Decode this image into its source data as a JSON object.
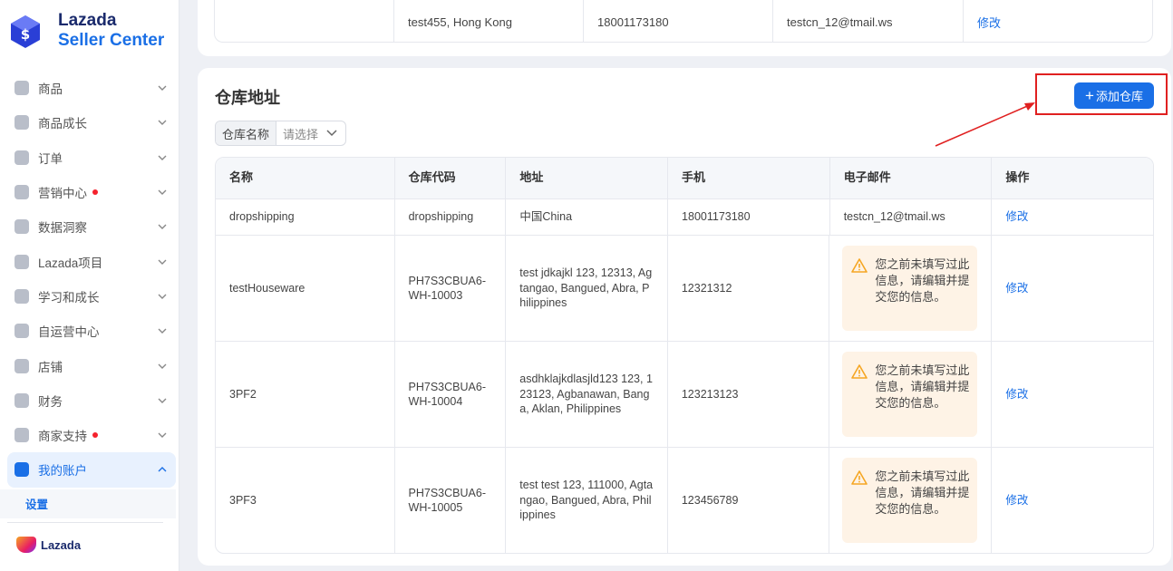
{
  "brand": {
    "line1": "Lazada",
    "line2": "Seller Center",
    "footer": "Lazada",
    "accent": "#1a6fe6"
  },
  "sidebar": {
    "items": [
      {
        "label": "商品",
        "dot": false,
        "icon": "product-icon"
      },
      {
        "label": "商品成长",
        "dot": false,
        "icon": "growth-icon"
      },
      {
        "label": "订单",
        "dot": false,
        "icon": "order-icon"
      },
      {
        "label": "营销中心",
        "dot": true,
        "icon": "marketing-icon"
      },
      {
        "label": "数据洞察",
        "dot": false,
        "icon": "data-icon"
      },
      {
        "label": "Lazada项目",
        "dot": false,
        "icon": "dollar-icon"
      },
      {
        "label": "学习和成长",
        "dot": false,
        "icon": "learning-icon"
      },
      {
        "label": "自运营中心",
        "dot": false,
        "icon": "share-icon"
      },
      {
        "label": "店铺",
        "dot": false,
        "icon": "store-icon"
      },
      {
        "label": "财务",
        "dot": false,
        "icon": "wallet-icon"
      },
      {
        "label": "商家支持",
        "dot": true,
        "icon": "help-icon"
      },
      {
        "label": "我的账户",
        "dot": false,
        "icon": "account-icon",
        "active": true
      }
    ],
    "sub_item": "设置"
  },
  "top_row": {
    "address": "test455, Hong Kong",
    "phone": "18001173180",
    "email": "testcn_12@tmail.ws",
    "action": "修改"
  },
  "warehouse": {
    "title": "仓库地址",
    "add_button": "添加仓库",
    "filter_label": "仓库名称",
    "filter_placeholder": "请选择",
    "columns": [
      "名称",
      "仓库代码",
      "地址",
      "手机",
      "电子邮件",
      "操作"
    ],
    "rows": [
      {
        "name": "dropshipping",
        "code": "dropshipping",
        "address": "中国China",
        "phone": "18001173180",
        "email": "testcn_12@tmail.ws",
        "action": "修改"
      },
      {
        "name": "testHouseware",
        "code": "PH7S3CBUA6-WH-10003",
        "address": "test jdkajkl 123, 12313, Agtangao, Bangued, Abra, Philippines",
        "phone": "12321312",
        "warning": "您之前未填写过此信息，请编辑并提交您的信息。",
        "action": "修改"
      },
      {
        "name": "3PF2",
        "code": "PH7S3CBUA6-WH-10004",
        "address": "asdhklajkdlasjld123 123, 123123, Agbanawan, Banga, Aklan, Philippines",
        "phone": "123213123",
        "warning": "您之前未填写过此信息，请编辑并提交您的信息。",
        "action": "修改"
      },
      {
        "name": "3PF3",
        "code": "PH7S3CBUA6-WH-10005",
        "address": "test test 123, 111000, Agtangao, Bangued, Abra, Philippines",
        "phone": "123456789",
        "warning": "您之前未填写过此信息，请编辑并提交您的信息。",
        "action": "修改"
      }
    ]
  }
}
